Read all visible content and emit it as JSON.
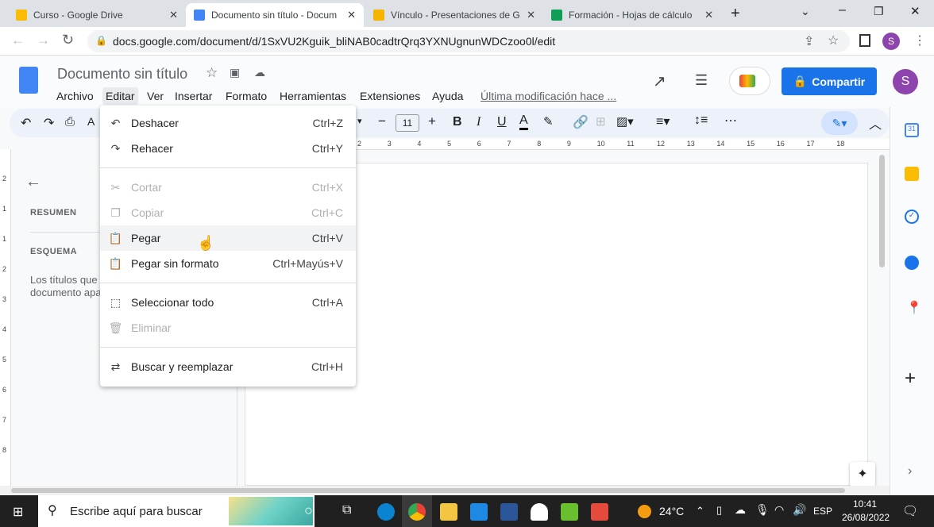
{
  "browser": {
    "tabs": [
      {
        "title": "Curso - Google Drive",
        "color": "#fbbc04"
      },
      {
        "title": "Documento sin título - Docum",
        "color": "#4285f4"
      },
      {
        "title": "Vínculo - Presentaciones de G",
        "color": "#f4b400"
      },
      {
        "title": "Formación - Hojas de cálculo",
        "color": "#0f9d58"
      }
    ],
    "url": "docs.google.com/document/d/1SxVU2Kguik_bliNAB0cadtrQrq3YXNUgnunWDCzoo0l/edit",
    "profile": "S"
  },
  "doc": {
    "title": "Documento sin título",
    "menus": [
      "Archivo",
      "Editar",
      "Ver",
      "Insertar",
      "Formato",
      "Herramientas",
      "Extensiones",
      "Ayuda"
    ],
    "last_edit": "Última modificación hace ...",
    "share": "Compartir",
    "avatar": "S",
    "font_size": "11"
  },
  "ruler": [
    "2",
    "3",
    "4",
    "5",
    "6",
    "7",
    "8",
    "9",
    "10",
    "11",
    "12",
    "13",
    "14",
    "15",
    "16",
    "17",
    "18"
  ],
  "vruler": [
    "2",
    "1",
    "1",
    "2",
    "3",
    "4",
    "5",
    "6",
    "7",
    "8"
  ],
  "outline": {
    "summary": "RESUMEN",
    "outline": "ESQUEMA",
    "hint": "Los títulos que añadas al documento aparecerán aquí."
  },
  "edit_menu": [
    {
      "icon": "undo-icon",
      "glyph": "↶",
      "label": "Deshacer",
      "shortcut": "Ctrl+Z",
      "disabled": false
    },
    {
      "icon": "redo-icon",
      "glyph": "↷",
      "label": "Rehacer",
      "shortcut": "Ctrl+Y",
      "disabled": false
    },
    {
      "icon": "scissors-icon",
      "glyph": "✂",
      "label": "Cortar",
      "shortcut": "Ctrl+X",
      "disabled": true
    },
    {
      "icon": "copy-icon",
      "glyph": "❐",
      "label": "Copiar",
      "shortcut": "Ctrl+C",
      "disabled": true
    },
    {
      "icon": "paste-icon",
      "glyph": "📋",
      "label": "Pegar",
      "shortcut": "Ctrl+V",
      "disabled": false
    },
    {
      "icon": "paste-plain-icon",
      "glyph": "📋",
      "label": "Pegar sin formato",
      "shortcut": "Ctrl+Mayús+V",
      "disabled": false
    },
    {
      "icon": "select-all-icon",
      "glyph": "⬚",
      "label": "Seleccionar todo",
      "shortcut": "Ctrl+A",
      "disabled": false
    },
    {
      "icon": "delete-icon",
      "glyph": "🗑",
      "label": "Eliminar",
      "shortcut": "",
      "disabled": true
    },
    {
      "icon": "find-replace-icon",
      "glyph": "⇄",
      "label": "Buscar y reemplazar",
      "shortcut": "Ctrl+H",
      "disabled": false
    }
  ],
  "taskbar": {
    "search": "Escribe aquí para buscar",
    "weather": "24°C",
    "lang": "ESP",
    "time": "10:41",
    "date": "26/08/2022"
  },
  "colors": {
    "accent": "#1a73e8",
    "taskbar": "#202020"
  }
}
